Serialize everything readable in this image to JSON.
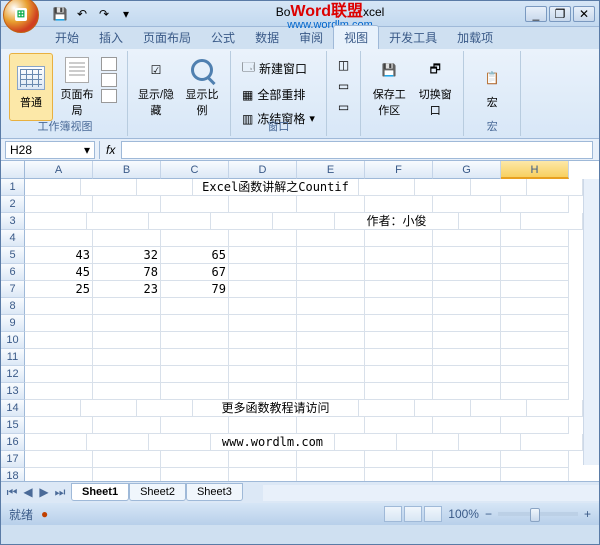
{
  "title": {
    "watermark_main": "Word联盟",
    "watermark_sub": "www.wordlm.com",
    "prefix": "Bo",
    "suffix": "xcel"
  },
  "qat": {
    "save": "💾",
    "undo": "↶",
    "redo": "↷",
    "dd": "▾"
  },
  "win": {
    "min": "_",
    "max": "❐",
    "close": "✕",
    "help": "?"
  },
  "tabs": [
    "开始",
    "插入",
    "页面布局",
    "公式",
    "数据",
    "审阅",
    "视图",
    "开发工具",
    "加载项"
  ],
  "ribbon": {
    "group1": {
      "label": "工作簿视图",
      "normal": "普通",
      "page_layout": "页面布局"
    },
    "group2": {
      "show_hide": "显示/隐藏",
      "zoom": "显示比例"
    },
    "group3": {
      "label": "窗口",
      "new_window": "新建窗口",
      "arrange": "全部重排",
      "freeze": "冻结窗格",
      "save_ws": "保存工作区",
      "switch": "切换窗口"
    },
    "group4": {
      "label": "宏",
      "macro": "宏"
    }
  },
  "namebox": "H28",
  "fx": "fx",
  "columns": [
    "A",
    "B",
    "C",
    "D",
    "E",
    "F",
    "G",
    "H"
  ],
  "rows": [
    "1",
    "2",
    "3",
    "4",
    "5",
    "6",
    "7",
    "8",
    "9",
    "10",
    "11",
    "12",
    "13",
    "14",
    "15",
    "16",
    "17",
    "18"
  ],
  "cell_data": {
    "r1": {
      "title": "Excel函数讲解之Countif"
    },
    "r3": {
      "author": "作者：小俊"
    },
    "r5": {
      "a": "43",
      "b": "32",
      "c": "65"
    },
    "r6": {
      "a": "45",
      "b": "78",
      "c": "67"
    },
    "r7": {
      "a": "25",
      "b": "23",
      "c": "79"
    },
    "r14": {
      "more": "更多函数教程请访问"
    },
    "r16": {
      "url": "www.wordlm.com"
    }
  },
  "sheets": [
    "Sheet1",
    "Sheet2",
    "Sheet3"
  ],
  "status": {
    "ready": "就绪",
    "zoom": "100%"
  },
  "chart_data": {
    "type": "table",
    "title": "Excel函数讲解之Countif",
    "columns": [
      "A",
      "B",
      "C"
    ],
    "rows": [
      [
        43,
        32,
        65
      ],
      [
        45,
        78,
        67
      ],
      [
        25,
        23,
        79
      ]
    ]
  }
}
